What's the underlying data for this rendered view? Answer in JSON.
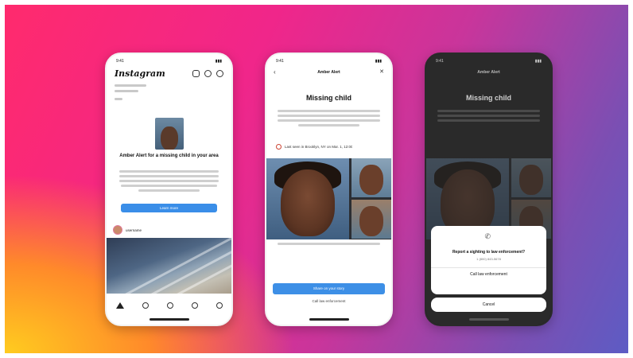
{
  "phone1": {
    "status_time": "9:41",
    "app_name": "Instagram",
    "alert_title": "Amber Alert for a missing child in your area",
    "alert_button": "Learn more",
    "post_handle": "username",
    "nav_icons": [
      "home-icon",
      "search-icon",
      "reels-icon",
      "shop-icon",
      "profile-icon"
    ]
  },
  "phone2": {
    "status_time": "9:41",
    "header": "Amber Alert",
    "title": "Missing child",
    "location": "Last seen in Brooklyn, NY on Mar. 1, 12:00",
    "primary_button": "Share on your story",
    "secondary_link": "Call law enforcement"
  },
  "phone3": {
    "status_time": "9:41",
    "header": "Amber Alert",
    "title": "Missing child",
    "sheet_title": "Report a sighting to law enforcement?",
    "sheet_sub": "1 (800) 843-5678",
    "sheet_button": "Call law enforcement",
    "cancel": "Cancel"
  },
  "colors": {
    "gradient_pink": "#ff2a6d",
    "gradient_purple": "#5d5cc4",
    "gradient_yellow": "#ffcc1f",
    "button_blue": "#3d8fe6"
  }
}
